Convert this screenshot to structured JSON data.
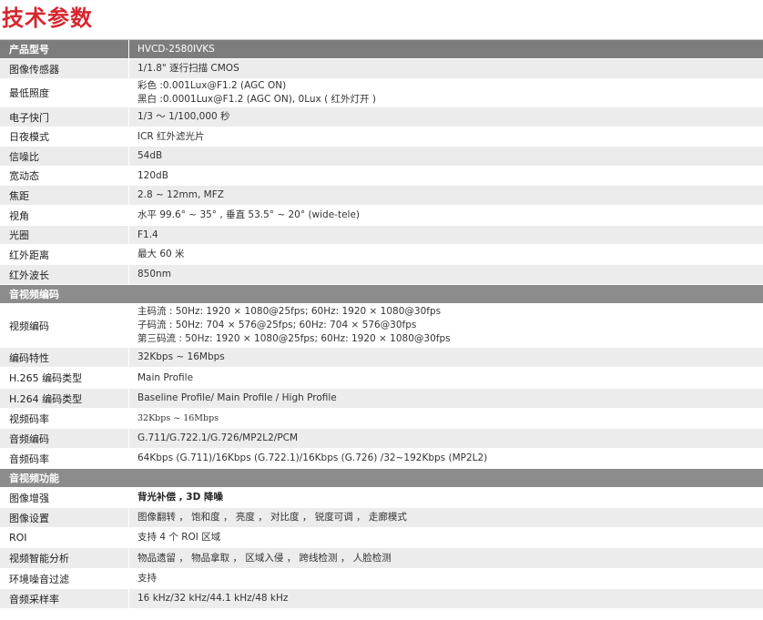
{
  "title": "技术参数",
  "header": {
    "key": "产品型号",
    "value": "HVCD-2580IVKS"
  },
  "basic": [
    {
      "key": "图像传感器",
      "lines": [
        "1/1.8\" 逐行扫描 CMOS"
      ]
    },
    {
      "key": "最低照度",
      "lines": [
        "彩色 :0.001Lux@F1.2 (AGC ON)",
        "黑白 :0.0001Lux@F1.2 (AGC ON), 0Lux ( 红外灯开 )"
      ]
    },
    {
      "key": "电子快门",
      "lines": [
        "1/3 ～ 1/100,000 秒"
      ]
    },
    {
      "key": "日夜模式",
      "lines": [
        "ICR 红外滤光片"
      ]
    },
    {
      "key": "信噪比",
      "lines": [
        "54dB"
      ]
    },
    {
      "key": "宽动态",
      "lines": [
        "120dB"
      ]
    },
    {
      "key": "焦距",
      "lines": [
        "2.8 ~ 12mm, MFZ"
      ]
    },
    {
      "key": "视角",
      "lines": [
        "水平 99.6° ~ 35° , 垂直 53.5° ~ 20° (wide-tele)"
      ]
    },
    {
      "key": "光圈",
      "lines": [
        "F1.4"
      ]
    },
    {
      "key": "红外距离",
      "lines": [
        "最大 60 米"
      ]
    },
    {
      "key": "红外波长",
      "lines": [
        "850nm"
      ]
    }
  ],
  "section_av": "音视频编码",
  "av": [
    {
      "key": "视频编码",
      "lines": [
        "主码流 : 50Hz: 1920 × 1080@25fps; 60Hz: 1920 × 1080@30fps",
        "子码流 : 50Hz: 704 × 576@25fps; 60Hz: 704 × 576@30fps",
        "第三码流 : 50Hz: 1920 × 1080@25fps; 60Hz: 1920 × 1080@30fps"
      ]
    },
    {
      "key": "编码特性",
      "lines": [
        "32Kbps ~ 16Mbps"
      ]
    },
    {
      "key": "H.265 编码类型",
      "lines": [
        "Main Profile"
      ]
    },
    {
      "key": "H.264 编码类型",
      "lines": [
        "Baseline Profile/ Main Profile / High Profile"
      ]
    },
    {
      "key": "视频码率",
      "lines": [
        "32Kbps ~ 16Mbps"
      ],
      "serif": true
    },
    {
      "key": "音频编码",
      "lines": [
        "G.711/G.722.1/G.726/MP2L2/PCM"
      ]
    },
    {
      "key": "音频码率",
      "lines": [
        "64Kbps (G.711)/16Kbps (G.722.1)/16Kbps (G.726) /32~192Kbps (MP2L2)"
      ]
    }
  ],
  "section_func": "音视频功能",
  "func": [
    {
      "key": "图像增强",
      "lines": [
        "背光补偿 , 3D 降噪"
      ],
      "bold": true
    },
    {
      "key": "图像设置",
      "lines": [
        "图像翻转 ， 饱和度 ， 亮度 ， 对比度 ， 锐度可调 ， 走廊模式"
      ]
    },
    {
      "key": "ROI",
      "lines": [
        "支持 4 个 ROI 区域"
      ]
    },
    {
      "key": "视频智能分析",
      "lines": [
        "物品遗留 ， 物品拿取 ， 区域入侵 ， 跨线检测 ， 人脸检测"
      ]
    },
    {
      "key": "环境噪音过滤",
      "lines": [
        "支持"
      ]
    },
    {
      "key": "音频采样率",
      "lines": [
        "16 kHz/32 kHz/44.1 kHz/48 kHz"
      ]
    }
  ]
}
